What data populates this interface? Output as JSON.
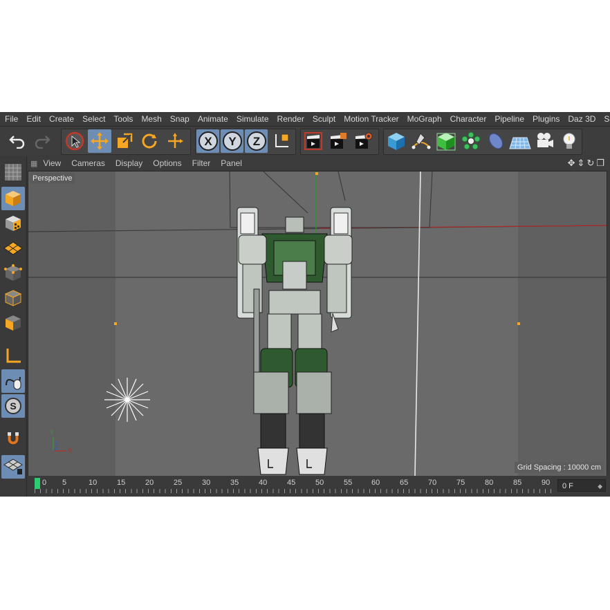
{
  "menu": [
    "File",
    "Edit",
    "Create",
    "Select",
    "Tools",
    "Mesh",
    "Snap",
    "Animate",
    "Simulate",
    "Render",
    "Sculpt",
    "Motion Tracker",
    "MoGraph",
    "Character",
    "Pipeline",
    "Plugins",
    "Daz 3D",
    "Scrip"
  ],
  "toolbar_icons": [
    "undo-icon",
    "redo-icon",
    "live-selection-icon",
    "move-icon",
    "scale-icon",
    "rotate-icon",
    "transform-icon",
    "x-axis-icon",
    "y-axis-icon",
    "z-axis-icon",
    "coordinate-system-icon",
    "render-view-icon",
    "render-picture-viewer-icon",
    "render-settings-icon",
    "cube-icon",
    "pen-icon",
    "subdivision-icon",
    "cloner-icon",
    "deformer-icon",
    "floor-icon",
    "camera-icon",
    "light-icon"
  ],
  "axis_labels": {
    "x": "X",
    "y": "Y",
    "z": "Z"
  },
  "palette_icons": [
    "make-editable-icon",
    "model-icon",
    "texture-icon",
    "workplane-icon",
    "points-icon",
    "edges-icon",
    "polygons-icon",
    "axis-icon",
    "tweak-icon",
    "solo-icon",
    "snap-icon",
    "grid-icon"
  ],
  "viewport_menu": [
    "View",
    "Cameras",
    "Display",
    "Options",
    "Filter",
    "Panel"
  ],
  "viewport": {
    "label": "Perspective",
    "grid_spacing": "Grid Spacing : 10000 cm",
    "axis_x": "X",
    "axis_y": "Y",
    "axis_z": "Z"
  },
  "timeline": {
    "ticks": [
      "0",
      "5",
      "10",
      "15",
      "20",
      "25",
      "30",
      "35",
      "40",
      "45",
      "50",
      "55",
      "60",
      "65",
      "70",
      "75",
      "80",
      "85",
      "90"
    ],
    "current_frame": "0 F"
  },
  "colors": {
    "selected": "#6d8db5",
    "accent": "#f5a623",
    "viewport": "#6a6a6a"
  }
}
